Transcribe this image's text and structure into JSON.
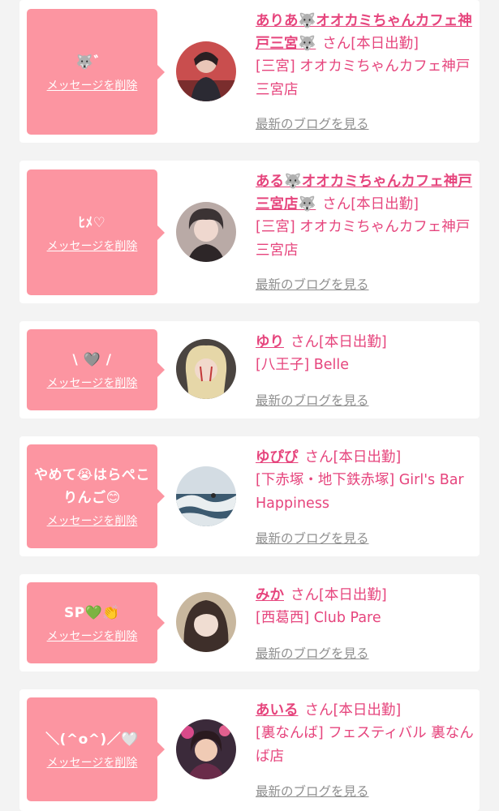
{
  "delete_label": "メッセージを削除",
  "blog_label": "最新のブログを見る",
  "san_suffix": "さん",
  "status": "[本日出勤]",
  "cards": [
    {
      "message": "🐺゛",
      "name": "ありあ🐺オオカミちゃんカフェ神戸三宮🐺",
      "shop": "[三宮] オオカミちゃんカフェ神戸三宮店"
    },
    {
      "message": "ﾋﾒ♡",
      "name": "ある🐺オオカミちゃんカフェ神戸三宮店🐺",
      "shop": "[三宮] オオカミちゃんカフェ神戸三宮店"
    },
    {
      "message": "\\ 🩶 /",
      "name": "ゆり",
      "shop": "[八王子] Belle"
    },
    {
      "message": "やめて😭はらぺこりんご😊",
      "name": "ゆぴぴ",
      "shop": "[下赤塚・地下鉄赤塚] Girl's Bar Happiness"
    },
    {
      "message": "SP💚👏",
      "name": "みか",
      "shop": "[西葛西] Club Pare"
    },
    {
      "message": "＼(^o^)／🤍",
      "name": "あいる",
      "shop": "[裏なんば] フェスティバル 裏なんば店"
    }
  ],
  "colors": {
    "accent": "#e6457d",
    "message_bg": "#fc95a1",
    "page_bg": "#f3f3f3",
    "link_gray": "#8f8f8f"
  }
}
